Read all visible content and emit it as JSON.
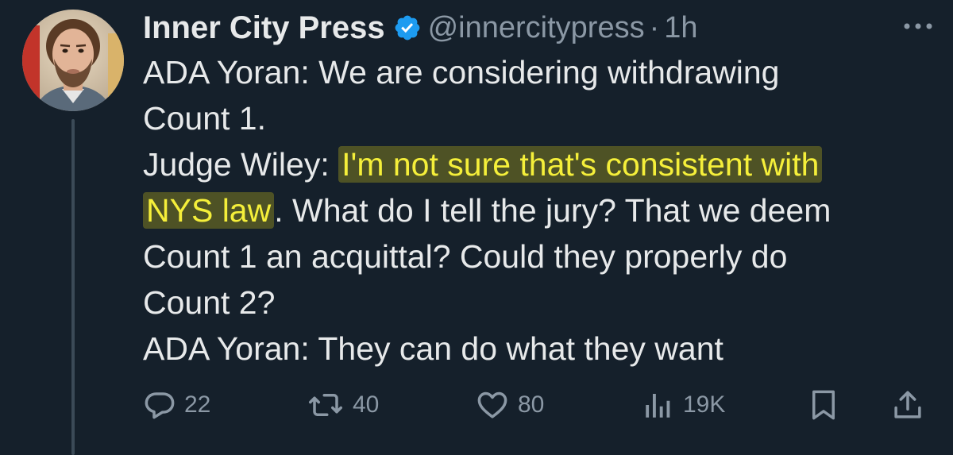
{
  "tweet": {
    "author_name": "Inner City Press",
    "handle": "@innercitypress",
    "separator": "·",
    "time": "1h",
    "lines": [
      {
        "before": "ADA Yoran: We are considering withdrawing",
        "highlight": "",
        "after": ""
      },
      {
        "before": "Count 1.",
        "highlight": "",
        "after": ""
      },
      {
        "before": "Judge Wiley: ",
        "highlight": "I'm not sure that's consistent with",
        "after": ""
      },
      {
        "before": "",
        "highlight": "NYS law",
        "after": ". What do I tell the jury? That we deem"
      },
      {
        "before": "Count 1 an acquittal? Could they properly do",
        "highlight": "",
        "after": ""
      },
      {
        "before": "Count 2?",
        "highlight": "",
        "after": ""
      },
      {
        "before": "ADA Yoran: They can do what they want",
        "highlight": "",
        "after": ""
      }
    ],
    "highlight_color": "#f5ef3a"
  },
  "actions": {
    "replies": "22",
    "reposts": "40",
    "likes": "80",
    "views": "19K"
  },
  "icons": {
    "verified": "verified-badge-icon",
    "more": "more-options-icon",
    "reply": "reply-icon",
    "repost": "repost-icon",
    "like": "heart-icon",
    "views": "views-icon",
    "bookmark": "bookmark-icon",
    "share": "share-icon"
  },
  "colors": {
    "background": "#15202b",
    "text": "#e7e9ea",
    "muted": "#8b98a5",
    "verified": "#1d9bf0"
  }
}
